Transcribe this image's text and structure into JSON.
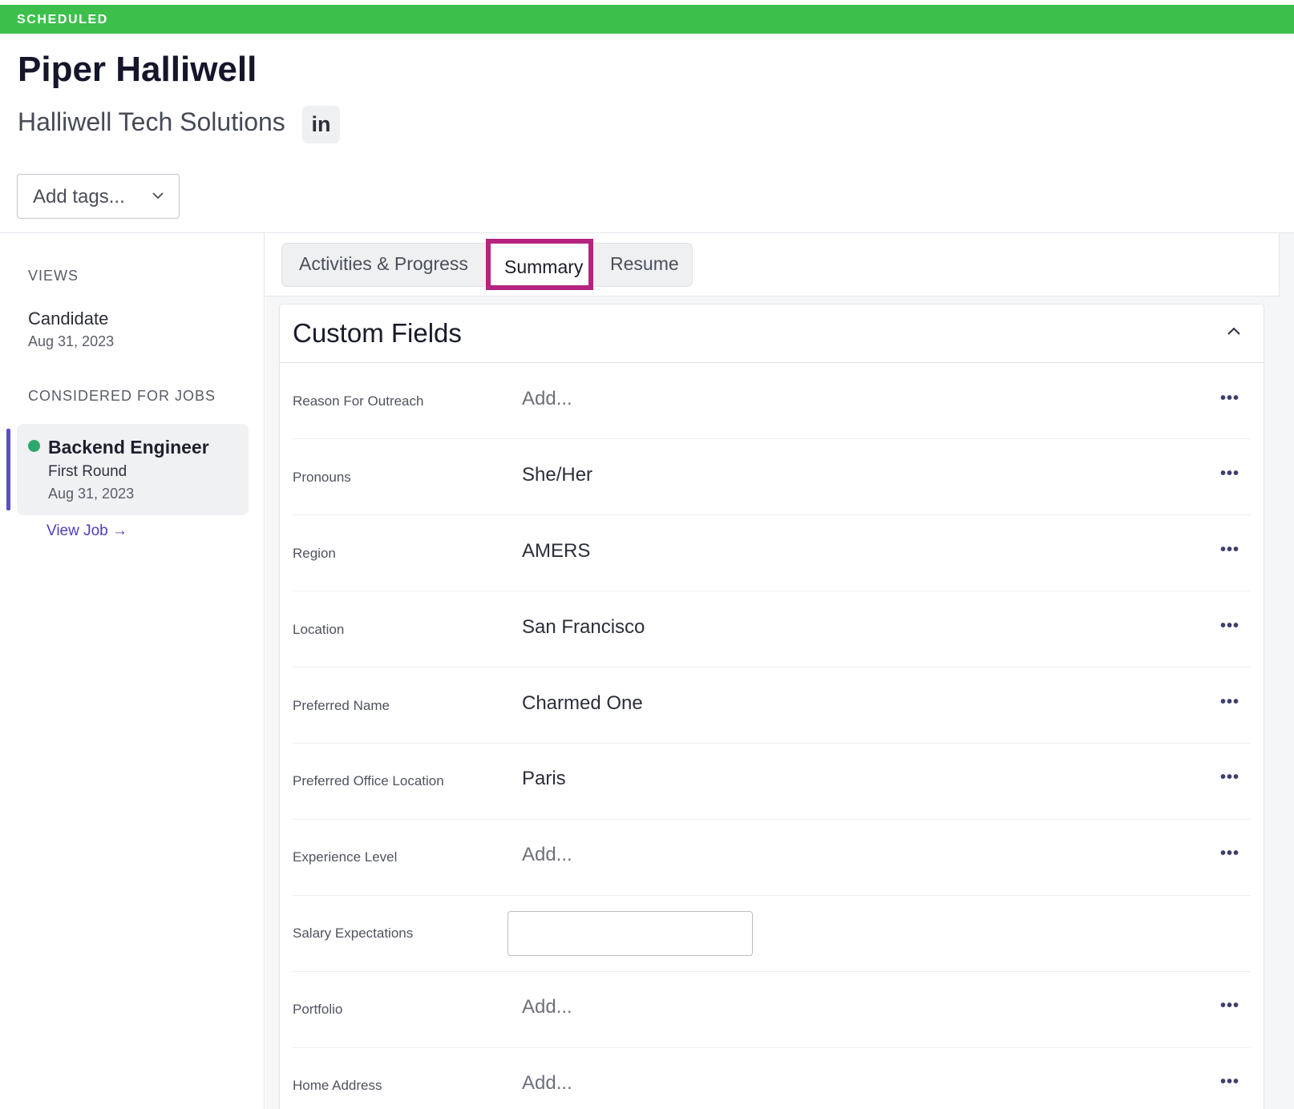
{
  "status": {
    "label": "SCHEDULED",
    "color": "#3cc04b"
  },
  "candidate": {
    "name": "Piper Halliwell",
    "company": "Halliwell Tech Solutions",
    "linkedin_label": "in"
  },
  "tags": {
    "placeholder": "Add tags..."
  },
  "sidebar": {
    "views_heading": "VIEWS",
    "view": {
      "name": "Candidate",
      "date": "Aug 31, 2023"
    },
    "jobs_heading": "CONSIDERED FOR JOBS",
    "job": {
      "title": "Backend Engineer",
      "stage": "First Round",
      "date": "Aug 31, 2023",
      "status_color": "#2ea86a"
    },
    "view_job_label": "View Job →"
  },
  "tabs": {
    "items": [
      {
        "label": "Activities & Progress"
      },
      {
        "label": "Summary",
        "active": true
      },
      {
        "label": "Resume"
      }
    ]
  },
  "custom_fields": {
    "title": "Custom Fields",
    "rows": [
      {
        "label": "Reason For Outreach",
        "value": "Add..."
      },
      {
        "label": "Pronouns",
        "value": "She/Her"
      },
      {
        "label": "Region",
        "value": "AMERS"
      },
      {
        "label": "Location",
        "value": "San Francisco"
      },
      {
        "label": "Preferred Name",
        "value": "Charmed One"
      },
      {
        "label": "Preferred Office Location",
        "value": "Paris"
      },
      {
        "label": "Experience Level",
        "value": "Add..."
      },
      {
        "label": "Salary Expectations",
        "value": ""
      },
      {
        "label": "Portfolio",
        "value": "Add..."
      },
      {
        "label": "Home Address",
        "value": "Add..."
      }
    ],
    "menu_glyph": "•••"
  },
  "colors": {
    "accent": "#5b4fc7",
    "highlight": "#b5247f",
    "link": "#4b3fbf"
  }
}
